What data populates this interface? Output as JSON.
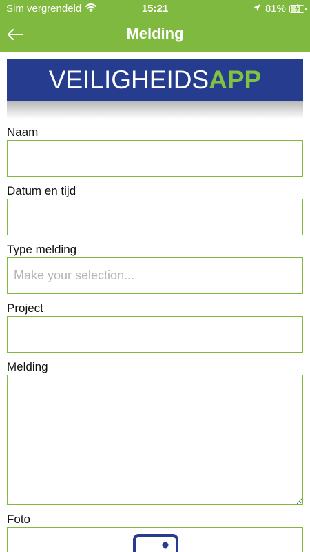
{
  "status_bar": {
    "carrier": "Sim vergrendeld",
    "time": "15:21",
    "battery": "81%",
    "battery_level": 0.81,
    "icons": [
      "wifi-icon",
      "location-arrow-icon",
      "battery-charging-icon"
    ]
  },
  "nav": {
    "title": "Melding",
    "back_icon": "arrow-left-icon"
  },
  "banner": {
    "logo_main": "VEILIGHEIDS",
    "logo_accent": "APP"
  },
  "form": {
    "naam": {
      "label": "Naam",
      "value": ""
    },
    "datum": {
      "label": "Datum en tijd",
      "value": ""
    },
    "type": {
      "label": "Type melding",
      "placeholder": "Make your selection..."
    },
    "project": {
      "label": "Project",
      "value": ""
    },
    "melding": {
      "label": "Melding",
      "value": ""
    },
    "foto": {
      "label": "Foto",
      "icon": "image-upload-icon"
    }
  },
  "colors": {
    "brand_green": "#80b93f",
    "banner_blue": "#263c8e",
    "logo_green": "#80c342",
    "placeholder_gray": "#b5b5b5"
  }
}
